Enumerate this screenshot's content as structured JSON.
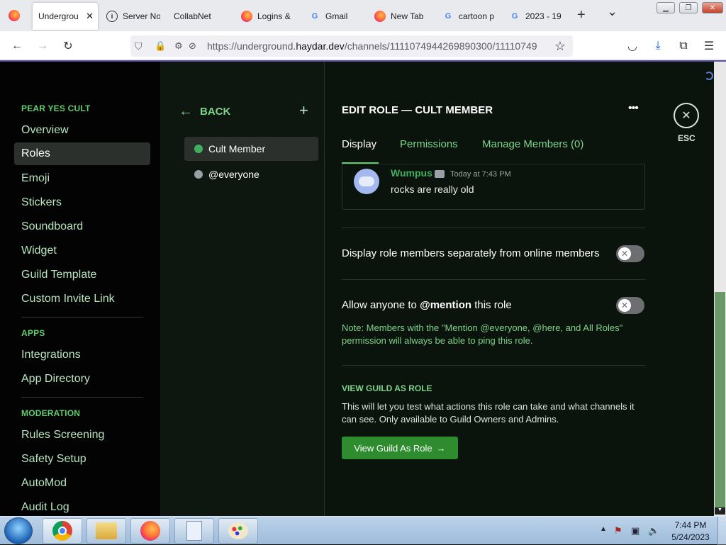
{
  "browser": {
    "tabs": [
      {
        "label": "Undergrou",
        "icon": "firefox-icon",
        "active": true
      },
      {
        "label": "Server No",
        "icon": "info-icon"
      },
      {
        "label": "CollabNet",
        "icon": "blank-icon"
      },
      {
        "label": "Logins &",
        "icon": "firefox-icon"
      },
      {
        "label": "Gmail",
        "icon": "google-icon"
      },
      {
        "label": "New Tab",
        "icon": "firefox-icon"
      },
      {
        "label": "cartoon p",
        "icon": "google-icon"
      },
      {
        "label": "2023 - 19",
        "icon": "google-icon"
      }
    ],
    "new_tab": "+",
    "tab_list": "⌄",
    "url_prefix": "https://underground.",
    "url_domain": "haydar.dev",
    "url_path": "/channels/1111074944269890300/11110749"
  },
  "sidebar": {
    "sections": [
      {
        "header": "PEAR YES CULT",
        "items": [
          "Overview",
          "Roles",
          "Emoji",
          "Stickers",
          "Soundboard",
          "Widget",
          "Guild Template",
          "Custom Invite Link"
        ]
      },
      {
        "header": "APPS",
        "items": [
          "Integrations",
          "App Directory"
        ]
      },
      {
        "header": "MODERATION",
        "items": [
          "Rules Screening",
          "Safety Setup",
          "AutoMod",
          "Audit Log"
        ]
      }
    ],
    "selected": "Roles"
  },
  "roles_panel": {
    "back_label": "BACK",
    "add_label": "+",
    "roles": [
      {
        "name": "Cult Member",
        "color": "#3fae5f",
        "selected": true
      },
      {
        "name": "@everyone",
        "color": "#9aa0a6",
        "selected": false
      }
    ]
  },
  "edit": {
    "title": "EDIT ROLE — CULT MEMBER",
    "more": "•••",
    "tabs": [
      "Display",
      "Permissions",
      "Manage Members (0)"
    ],
    "active_tab": "Display",
    "preview": {
      "username": "Wumpus",
      "timestamp": "Today at 7:43 PM",
      "message": "rocks are really old"
    },
    "toggle1": {
      "label": "Display role members separately from online members",
      "on": false
    },
    "toggle2": {
      "label_pre": "Allow anyone to ",
      "label_bold": "@mention",
      "label_post": " this role",
      "on": false,
      "note": "Note: Members with the \"Mention @everyone, @here, and All Roles\" permission will always be able to ping this role."
    },
    "view_guild": {
      "header": "VIEW GUILD AS ROLE",
      "desc": "This will let you test what actions this role can take and what channels it can see. Only available to Guild Owners and Admins.",
      "button": "View Guild As Role"
    },
    "esc_label": "ESC"
  },
  "taskbar": {
    "time": "7:44 PM",
    "date": "5/24/2023"
  },
  "colors": {
    "accent_green": "#5fcf6b",
    "button_green": "#2e8b2e",
    "bg_dark": "#0b130d"
  }
}
